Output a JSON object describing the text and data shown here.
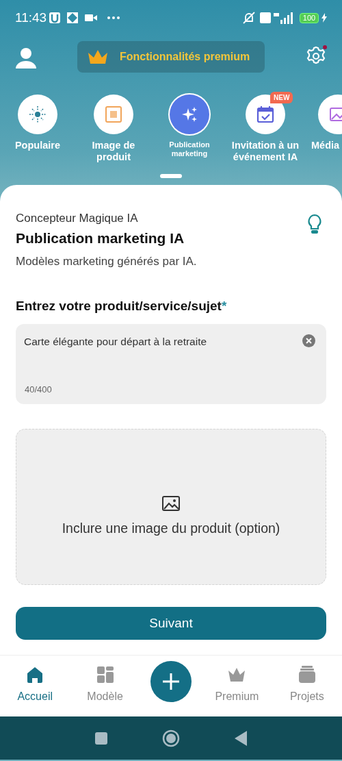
{
  "status_bar": {
    "time": "11:43",
    "battery": "100"
  },
  "header": {
    "premium_button": "Fonctionnalités premium"
  },
  "categories": [
    {
      "label": "Populaire",
      "selected": false
    },
    {
      "label": "Image de produit",
      "selected": false
    },
    {
      "label": "Publication marketing",
      "selected": true
    },
    {
      "label": "Invitation à un événement IA",
      "selected": false,
      "badge": "NEW"
    },
    {
      "label": "Média",
      "selected": false
    }
  ],
  "panel": {
    "overline": "Concepteur Magique IA",
    "title": "Publication marketing IA",
    "subtitle": "Modèles marketing générés par IA.",
    "field_label": "Entrez votre produit/service/sujet",
    "required_mark": "*",
    "field_value": "Carte élégante pour départ à la retraite",
    "counter": "40/400",
    "upload_label": "Inclure une image du produit (option)",
    "next_button": "Suivant"
  },
  "bottom_nav": [
    {
      "label": "Accueil",
      "selected": true
    },
    {
      "label": "Modèle",
      "selected": false
    },
    {
      "label": "Premium",
      "selected": false
    },
    {
      "label": "Projets",
      "selected": false
    }
  ]
}
